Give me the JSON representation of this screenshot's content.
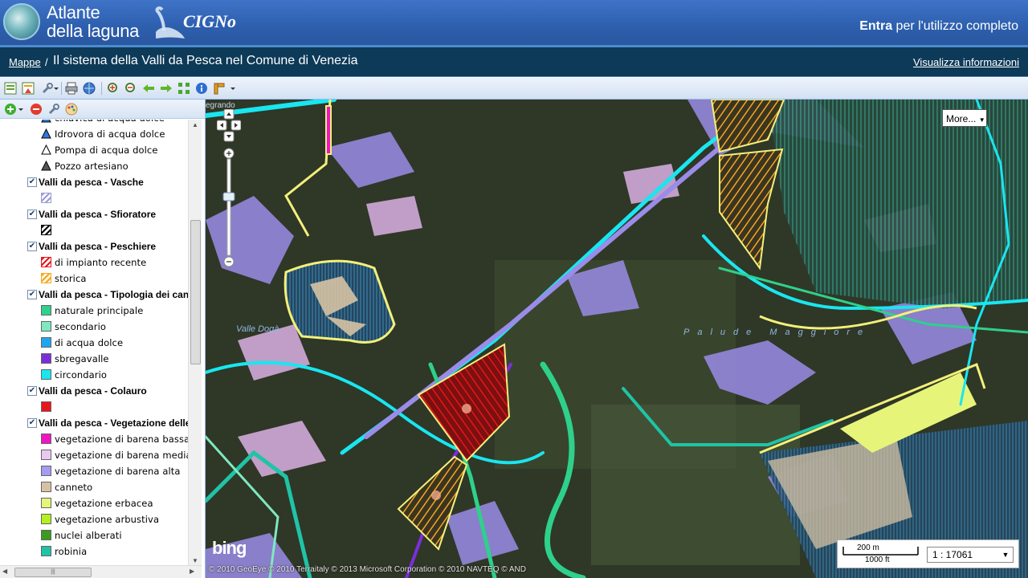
{
  "header": {
    "logo_line1": "Atlante",
    "logo_line2": "della laguna",
    "brand": "CIGNo",
    "login_strong": "Entra",
    "login_rest": " per l'utilizzo completo"
  },
  "titlebar": {
    "breadcrumb_link": "Mappe",
    "breadcrumb_sep": "/",
    "title": "Il sistema della Valli da Pesca nel Comune di Venezia",
    "info_link": "Visualizza informazioni"
  },
  "legend": {
    "items": [
      {
        "kind": "sym",
        "label": "chiavica di acqua dolce",
        "symbol": "triangle-blue"
      },
      {
        "kind": "sym",
        "label": "Idrovora di acqua dolce",
        "symbol": "triangle-blue"
      },
      {
        "kind": "sym",
        "label": "Pompa di acqua dolce",
        "symbol": "triangle-white"
      },
      {
        "kind": "sym",
        "label": "Pozzo artesiano",
        "symbol": "triangle-gray"
      },
      {
        "kind": "group",
        "label": "Valli da pesca - Vasche",
        "checked": true
      },
      {
        "kind": "sym",
        "label": "",
        "symbol": "hatch-light"
      },
      {
        "kind": "group",
        "label": "Valli da pesca - Sfioratore",
        "checked": true
      },
      {
        "kind": "sym",
        "label": "",
        "symbol": "hatch-black"
      },
      {
        "kind": "group",
        "label": "Valli da pesca - Peschiere",
        "checked": true
      },
      {
        "kind": "sym",
        "label": "di impianto recente",
        "symbol": "hatch-red"
      },
      {
        "kind": "sym",
        "label": "storica",
        "symbol": "hatch-orange"
      },
      {
        "kind": "group",
        "label": "Valli da pesca - Tipologia dei canali",
        "checked": true
      },
      {
        "kind": "sym",
        "label": "naturale principale",
        "color": "#2ed18a"
      },
      {
        "kind": "sym",
        "label": "secondario",
        "color": "#7fe8c0"
      },
      {
        "kind": "sym",
        "label": "di acqua dolce",
        "color": "#1ea7f0"
      },
      {
        "kind": "sym",
        "label": "sbregavalle",
        "color": "#7b2fd9"
      },
      {
        "kind": "sym",
        "label": "circondario",
        "color": "#19e6f0"
      },
      {
        "kind": "group",
        "label": "Valli da pesca - Colauro",
        "checked": true
      },
      {
        "kind": "sym",
        "label": "",
        "color": "#e8151b"
      },
      {
        "kind": "group",
        "label": "Valli da pesca - Vegetazione delle barene",
        "checked": true
      },
      {
        "kind": "sym",
        "label": "vegetazione di barena bassa",
        "color": "#f014c4"
      },
      {
        "kind": "sym",
        "label": "vegetazione di barena media",
        "color": "#eac8f2"
      },
      {
        "kind": "sym",
        "label": "vegetazione di barena alta",
        "color": "#a59bf0"
      },
      {
        "kind": "sym",
        "label": "canneto",
        "color": "#d6c2a3"
      },
      {
        "kind": "sym",
        "label": "vegetazione erbacea",
        "color": "#e6f57a"
      },
      {
        "kind": "sym",
        "label": "vegetazione arbustiva",
        "color": "#b2f01e"
      },
      {
        "kind": "sym",
        "label": "nuclei alberati",
        "color": "#3c9a1e"
      },
      {
        "kind": "sym",
        "label": "robinia",
        "color": "#1fc4a6"
      }
    ]
  },
  "map": {
    "more_button": "More...",
    "label_valle": "Valle Dogà",
    "label_palude": "Palude Maggiore",
    "label_top": "egrando",
    "bing": "bing",
    "copyright": "© 2010 GeoEye © 2010 Terraitaly © 2013 Microsoft Corporation © 2010 NAVTEQ © AND",
    "scale_m": "200 m",
    "scale_ft": "1000 ft",
    "scale_value": "1 : 17061"
  }
}
